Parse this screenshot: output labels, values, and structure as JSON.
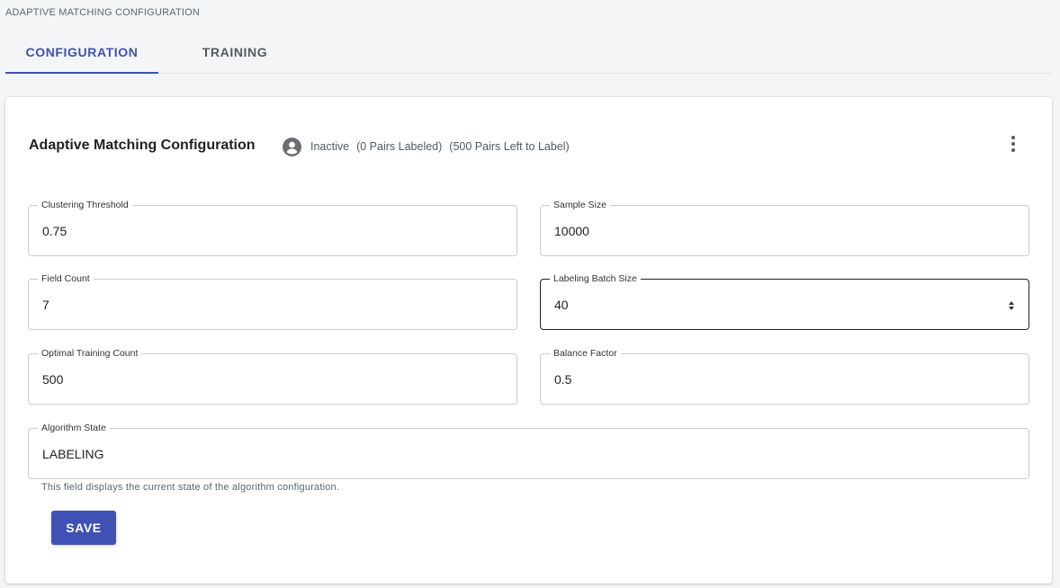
{
  "page": {
    "header": "ADAPTIVE MATCHING CONFIGURATION"
  },
  "tabs": [
    {
      "label": "CONFIGURATION",
      "active": true
    },
    {
      "label": "TRAINING",
      "active": false
    }
  ],
  "card": {
    "title": "Adaptive Matching Configuration",
    "status": {
      "icon": "account-circle-icon",
      "state": "Inactive",
      "pairs_labeled": "(0 Pairs Labeled)",
      "pairs_left": "(500 Pairs Left to Label)"
    },
    "menu_icon": "more-vert-icon"
  },
  "fields": {
    "clustering_threshold": {
      "label": "Clustering Threshold",
      "value": "0.75"
    },
    "sample_size": {
      "label": "Sample Size",
      "value": "10000"
    },
    "field_count": {
      "label": "Field Count",
      "value": "7"
    },
    "labeling_batch_size": {
      "label": "Labeling Batch Size",
      "value": "40"
    },
    "optimal_training_count": {
      "label": "Optimal Training Count",
      "value": "500"
    },
    "balance_factor": {
      "label": "Balance Factor",
      "value": "0.5"
    },
    "algorithm_state": {
      "label": "Algorithm State",
      "value": "LABELING",
      "helper": "This field displays the current state of the algorithm configuration."
    }
  },
  "actions": {
    "save_label": "SAVE"
  },
  "colors": {
    "accent": "#3f51b5",
    "background": "#f4f5f7",
    "card": "#ffffff"
  }
}
